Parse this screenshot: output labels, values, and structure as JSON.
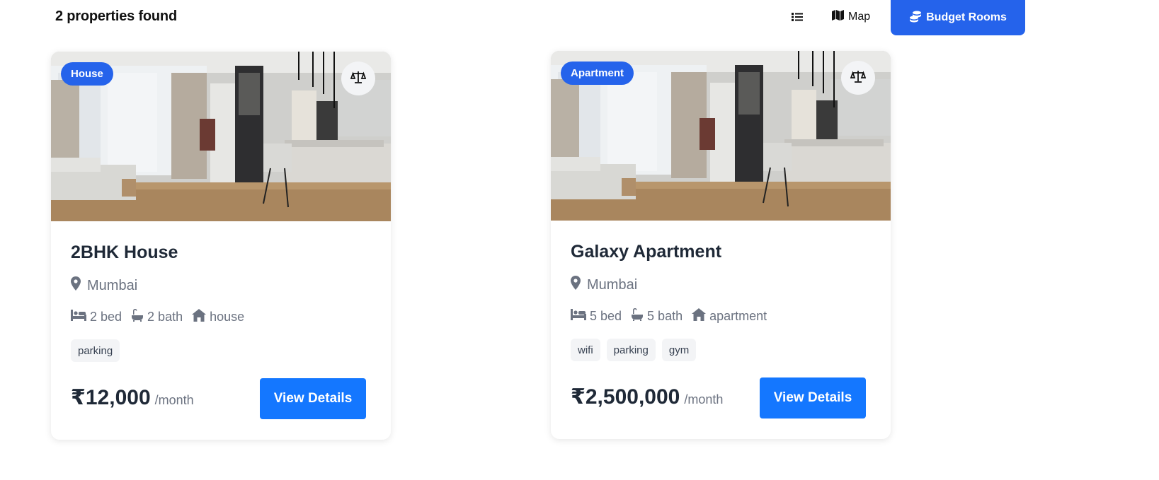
{
  "header": {
    "results_count": "2 properties found",
    "map_label": "Map",
    "budget_label": "Budget Rooms"
  },
  "colors": {
    "primary": "#2563eb",
    "button": "#1477ff",
    "muted_text": "#6b7280",
    "tag_bg": "#f3f4f6"
  },
  "properties": [
    {
      "type_badge": "House",
      "title": "2BHK House",
      "location": "Mumbai",
      "beds": "2 bed",
      "baths": "2 bath",
      "kind": "house",
      "tags": [
        "parking"
      ],
      "price": "₹12,000",
      "period": "/month",
      "cta": "View Details"
    },
    {
      "type_badge": "Apartment",
      "title": "Galaxy Apartment",
      "location": "Mumbai",
      "beds": "5 bed",
      "baths": "5 bath",
      "kind": "apartment",
      "tags": [
        "wifi",
        "parking",
        "gym"
      ],
      "price": "₹2,500,000",
      "period": "/month",
      "cta": "View Details"
    }
  ]
}
